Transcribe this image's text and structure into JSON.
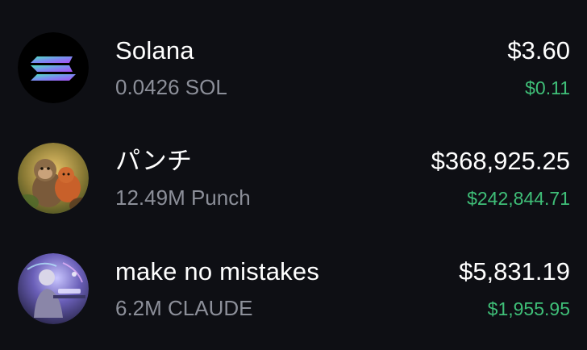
{
  "tokens": [
    {
      "name": "Solana",
      "amount": "0.0426 SOL",
      "value": "$3.60",
      "change": "$0.11",
      "icon": "solana-logo-icon"
    },
    {
      "name": "パンチ",
      "amount": "12.49M Punch",
      "value": "$368,925.25",
      "change": "$242,844.71",
      "icon": "monkey-token-avatar"
    },
    {
      "name": "make no mistakes",
      "amount": "6.2M CLAUDE",
      "value": "$5,831.19",
      "change": "$1,955.95",
      "icon": "claude-token-avatar"
    }
  ],
  "colors": {
    "background": "#0e0f14",
    "primary_text": "#ffffff",
    "secondary_text": "#8c8f99",
    "positive_change": "#3fbf78"
  }
}
